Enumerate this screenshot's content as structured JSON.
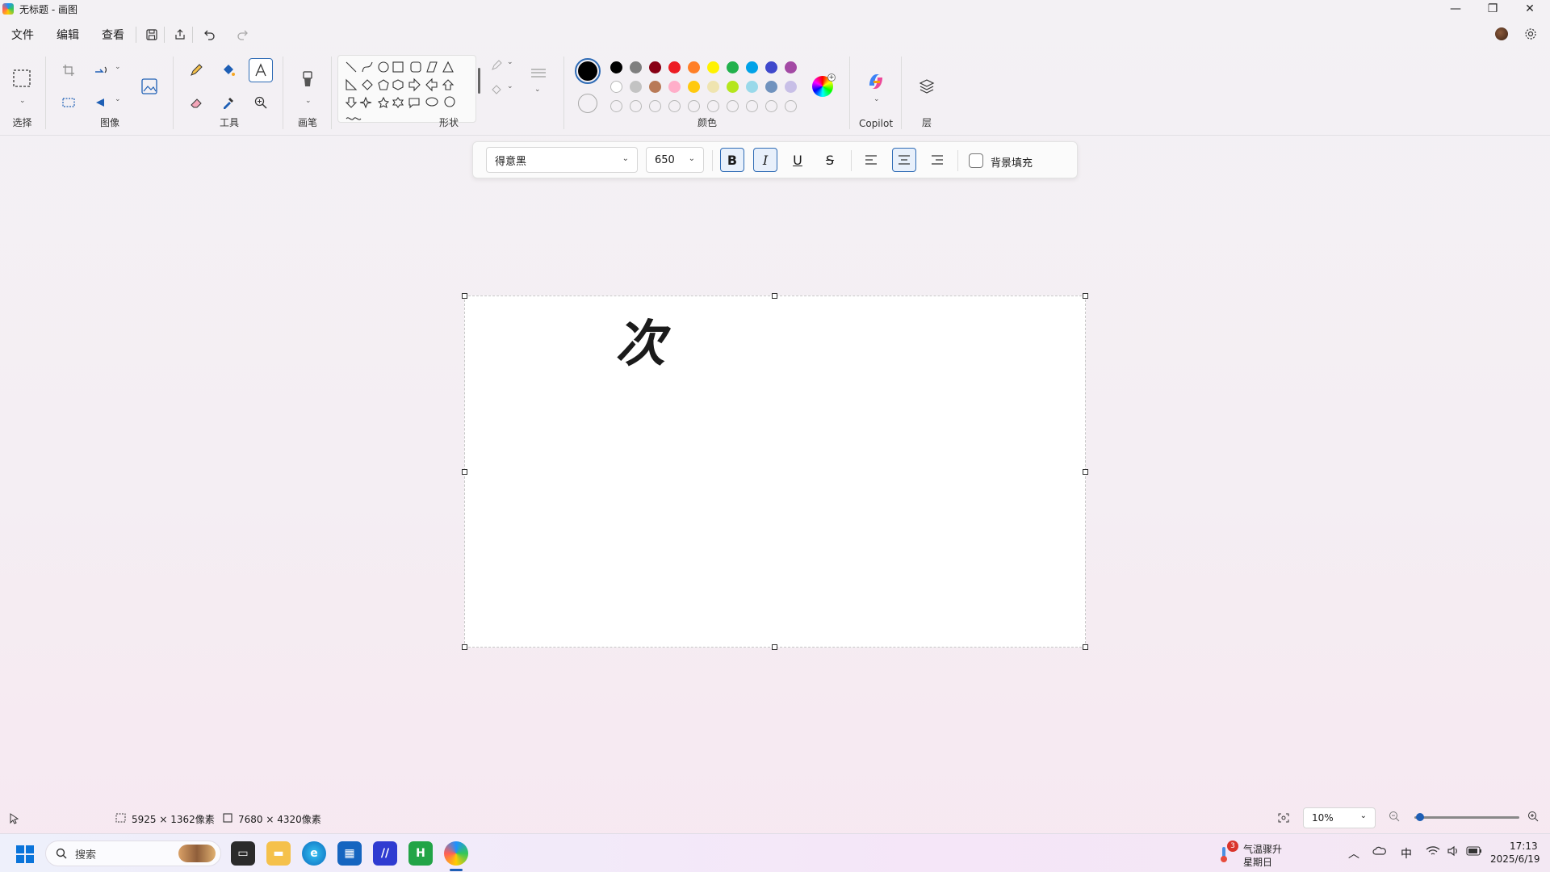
{
  "window": {
    "title": "无标题 - 画图",
    "controls": {
      "minimize": "—",
      "maximize": "❐",
      "close": "✕"
    }
  },
  "menu": {
    "items": [
      "文件",
      "编辑",
      "查看"
    ]
  },
  "ribbon": {
    "groups": {
      "select": "选择",
      "image": "图像",
      "tools": "工具",
      "brushes": "画笔",
      "shapes": "形状",
      "colors": "颜色",
      "copilot": "Copilot",
      "layers": "层"
    },
    "colors": {
      "primary": "#000000",
      "secondary": "#ffffff",
      "row1": [
        "#000000",
        "#7f7f7f",
        "#880015",
        "#ed1c24",
        "#ff7f27",
        "#fff200",
        "#22b14c",
        "#00a2e8",
        "#3f48cc",
        "#a349a4"
      ],
      "row2": [
        "#ffffff",
        "#c3c3c3",
        "#b97a57",
        "#ffaec9",
        "#ffc90e",
        "#efe4b0",
        "#b5e61d",
        "#99d9ea",
        "#7092be",
        "#c8bfe7"
      ],
      "row3_empty_count": 10
    },
    "accent": "#2e6bb5"
  },
  "text_toolbar": {
    "font": "得意黑",
    "size": "650",
    "bold": "B",
    "italic": "I",
    "underline": "U",
    "strike": "S",
    "bg_fill_label": "背景填充"
  },
  "canvas": {
    "text": "次"
  },
  "status": {
    "selection_size": "5925 × 1362像素",
    "canvas_size": "7680 × 4320像素",
    "zoom": "10%"
  },
  "taskbar": {
    "search_placeholder": "搜索",
    "weather_badge": "3",
    "weather_title": "气温骤升",
    "weather_sub": "星期日",
    "ime": "中",
    "time": "17:13",
    "date": "2025/6/19"
  }
}
